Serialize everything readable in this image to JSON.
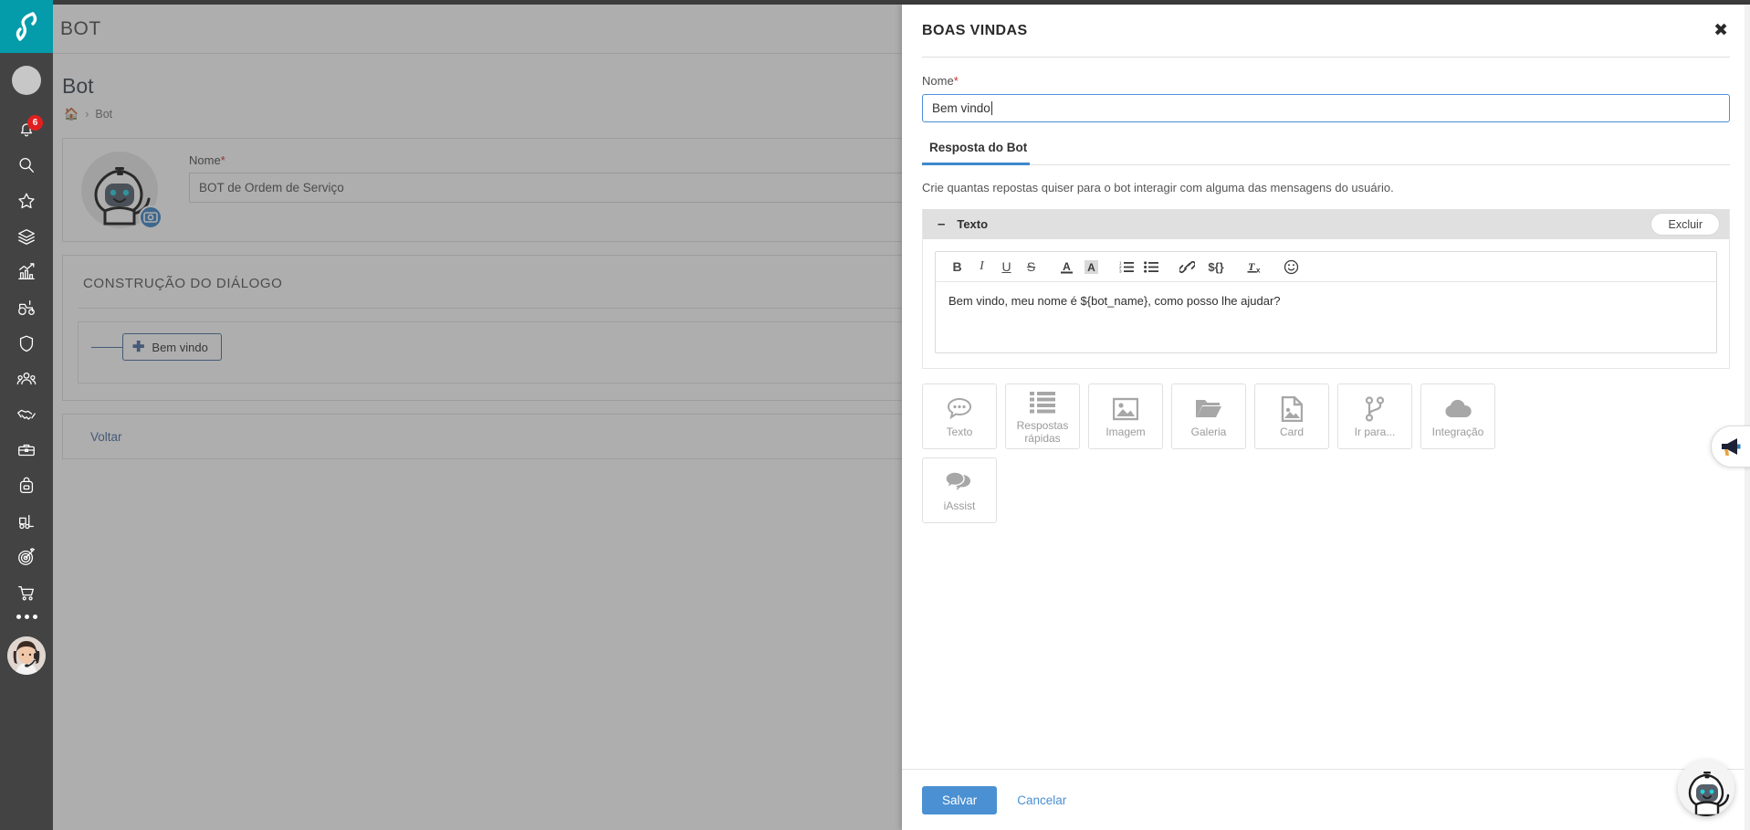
{
  "sidebar": {
    "brand_icon": "s-logo-icon",
    "brand_color": "#049baa",
    "profile_icon": "profile-avatar",
    "items": [
      {
        "icon": "bell-notification-icon",
        "badge": "6"
      },
      {
        "icon": "search-icon",
        "badge": ""
      },
      {
        "icon": "star-icon",
        "badge": ""
      },
      {
        "icon": "layers-stack-icon",
        "badge": ""
      },
      {
        "icon": "chart-growth-icon",
        "badge": ""
      },
      {
        "icon": "tractor-icon",
        "badge": ""
      },
      {
        "icon": "shield-icon",
        "badge": ""
      },
      {
        "icon": "people-group-icon",
        "badge": ""
      },
      {
        "icon": "handshake-icon",
        "badge": ""
      },
      {
        "icon": "briefcase-icon",
        "badge": ""
      },
      {
        "icon": "backpack-icon",
        "badge": ""
      },
      {
        "icon": "forklift-icon",
        "badge": ""
      },
      {
        "icon": "target-icon",
        "badge": ""
      },
      {
        "icon": "shopping-cart-icon",
        "badge": ""
      }
    ],
    "more_icon": "more-dots-icon",
    "agent_avatar": "support-agent-avatar"
  },
  "header": {
    "app_title": "BOT"
  },
  "page": {
    "title": "Bot",
    "breadcrumb": {
      "home_icon": "home-icon",
      "separator": "›",
      "current": "Bot"
    },
    "bot_card": {
      "avatar_icon": "bot-avatar-icon",
      "camera_badge_icon": "camera-icon",
      "name_label": "Nome",
      "required_mark": "*",
      "name_value": "BOT de Ordem de Serviço"
    },
    "dialog_section": {
      "title": "CONSTRUÇÃO DO DIÁLOGO",
      "node_label": "Bem vindo",
      "node_plus_icon": "plus-icon"
    },
    "footer": {
      "back_link": "Voltar"
    }
  },
  "modal": {
    "title": "BOAS VINDAS",
    "close_icon": "close-icon",
    "name_label": "Nome",
    "required_mark": "*",
    "name_value": "Bem vindo",
    "tabs": [
      {
        "label": "Resposta do Bot",
        "active": true
      }
    ],
    "hint": "Crie quantas repostas quiser para o bot interagir com alguma das mensagens do usuário.",
    "response_block": {
      "collapse_icon": "minus-icon",
      "type_label": "Texto",
      "delete_label": "Excluir",
      "toolbar": [
        {
          "icon": "bold-icon",
          "glyph": "B"
        },
        {
          "icon": "italic-icon",
          "glyph": "I"
        },
        {
          "icon": "underline-icon",
          "glyph": "U"
        },
        {
          "icon": "strikethrough-icon",
          "glyph": "S"
        },
        {
          "icon": "text-color-icon",
          "glyph": "A"
        },
        {
          "icon": "background-color-icon",
          "glyph": "A"
        },
        {
          "icon": "ordered-list-icon",
          "glyph": ""
        },
        {
          "icon": "unordered-list-icon",
          "glyph": ""
        },
        {
          "icon": "link-icon",
          "glyph": ""
        },
        {
          "icon": "variable-icon",
          "glyph": "${}"
        },
        {
          "icon": "clear-format-icon",
          "glyph": "Tx"
        },
        {
          "icon": "emoji-icon",
          "glyph": "☺"
        }
      ],
      "editor_text": "Bem vindo, meu nome é ${bot_name}, como posso lhe ajudar?"
    },
    "response_types": [
      {
        "label": "Texto",
        "icon": "speech-bubble-icon"
      },
      {
        "label": "Respostas rápidas",
        "icon": "list-icon"
      },
      {
        "label": "Imagem",
        "icon": "image-icon"
      },
      {
        "label": "Galeria",
        "icon": "folder-icon"
      },
      {
        "label": "Card",
        "icon": "card-document-icon"
      },
      {
        "label": "Ir para...",
        "icon": "branch-icon"
      },
      {
        "label": "Integração",
        "icon": "cloud-icon"
      },
      {
        "label": "iAssist",
        "icon": "chat-bubbles-icon"
      }
    ],
    "footer": {
      "save_label": "Salvar",
      "cancel_label": "Cancelar"
    }
  },
  "floating": {
    "megaphone_icon": "megaphone-icon",
    "bot_widget_icon": "bot-assistant-icon"
  },
  "colors": {
    "brand_teal": "#049baa",
    "sidebar_dark": "#434343",
    "primary_blue": "#4a90d2",
    "badge_red": "#e02020",
    "link_blue": "#4a6fa0"
  }
}
